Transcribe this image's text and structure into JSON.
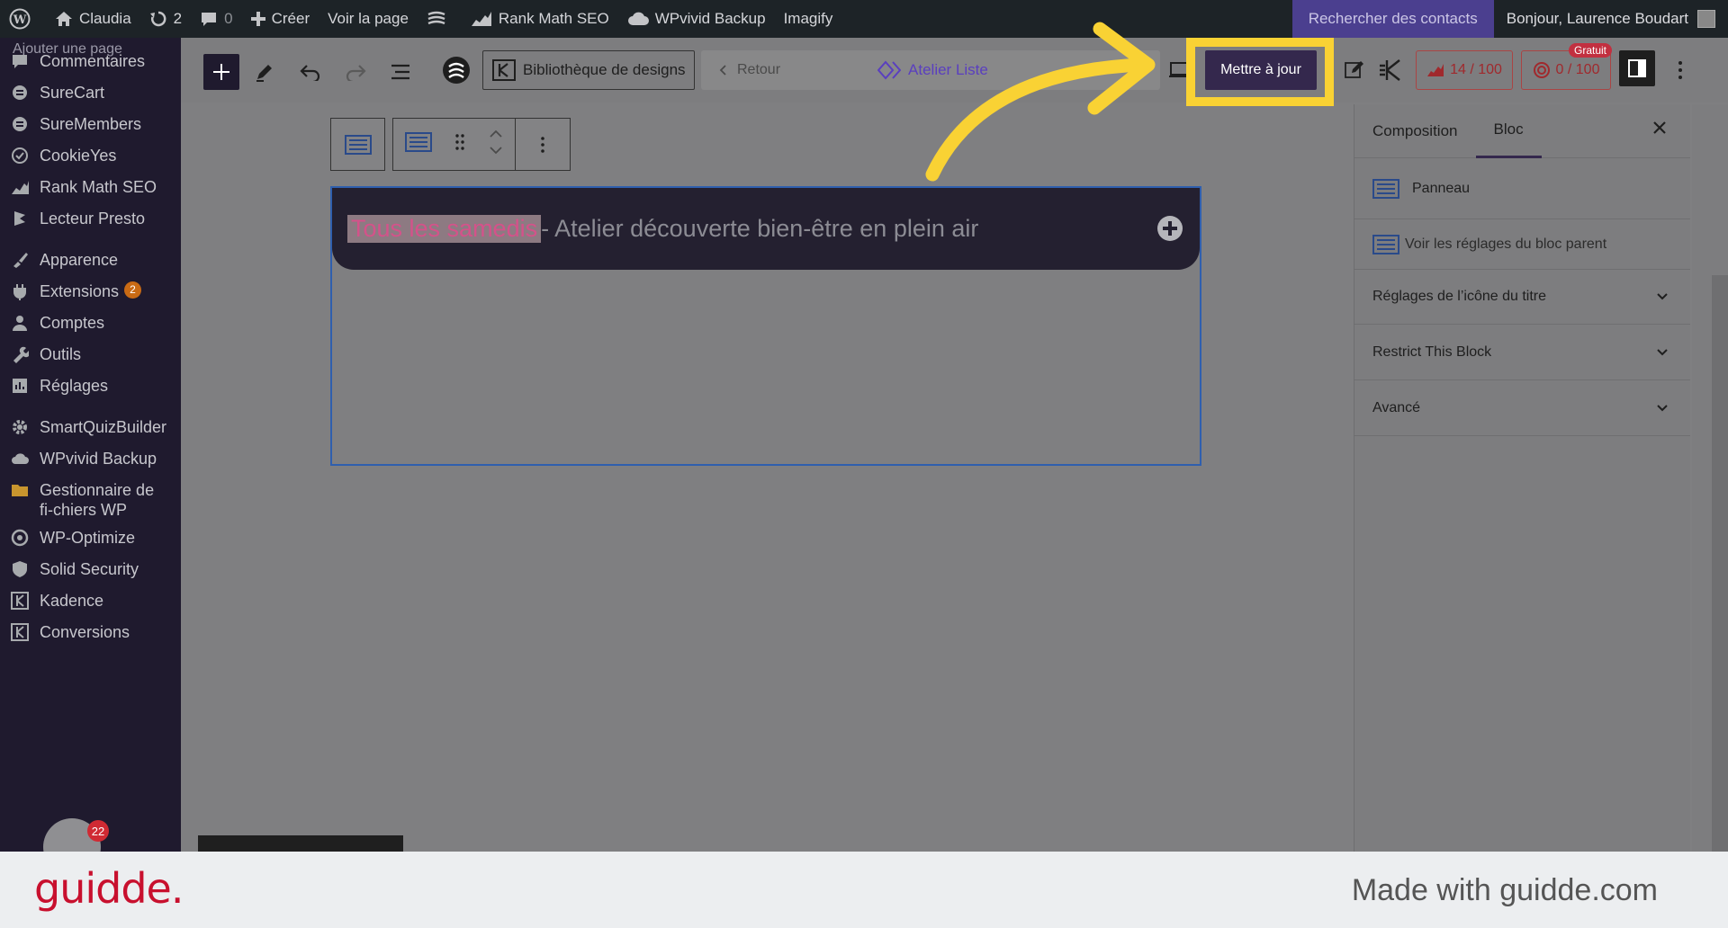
{
  "adminbar": {
    "site_name": "Claudia",
    "updates_count": "2",
    "comments_count": "0",
    "create_label": "Créer",
    "view_page_label": "Voir la page",
    "rankmath_label": "Rank Math SEO",
    "wpvivid_label": "WPvivid Backup",
    "imagify_label": "Imagify",
    "search_contacts_label": "Rechercher des contacts",
    "greeting": "Bonjour, Laurence Boudart"
  },
  "sidebar": {
    "submenu_tail": "Ajouter une page",
    "items": [
      {
        "label": "Commentaires",
        "icon": "comment-icon"
      },
      {
        "label": "SureCart",
        "icon": "surecart-icon"
      },
      {
        "label": "SureMembers",
        "icon": "suremembers-icon"
      },
      {
        "label": "CookieYes",
        "icon": "cookie-icon"
      },
      {
        "label": "Rank Math SEO",
        "icon": "rankmath-icon"
      },
      {
        "label": "Lecteur Presto",
        "icon": "presto-icon"
      },
      {
        "label": "Apparence",
        "icon": "brush-icon"
      },
      {
        "label": "Extensions",
        "icon": "plugin-icon",
        "badge": "2"
      },
      {
        "label": "Comptes",
        "icon": "user-icon"
      },
      {
        "label": "Outils",
        "icon": "wrench-icon"
      },
      {
        "label": "Réglages",
        "icon": "settings-icon"
      },
      {
        "label": "SmartQuizBuilder",
        "icon": "gear-icon"
      },
      {
        "label": "WPvivid Backup",
        "icon": "cloud-icon"
      },
      {
        "label": "Gestionnaire de fi-chiers WP",
        "icon": "folder-icon"
      },
      {
        "label": "WP-Optimize",
        "icon": "optimize-icon"
      },
      {
        "label": "Solid Security",
        "icon": "shield-icon"
      },
      {
        "label": "Kadence",
        "icon": "kadence-icon"
      },
      {
        "label": "Conversions",
        "icon": "kadence-icon"
      }
    ]
  },
  "toolbar": {
    "design_library_label": "Bibliothèque de designs",
    "back_label": "Retour",
    "doc_title": "Atelier Liste",
    "update_label": "Mettre à jour",
    "seo_score": "14 / 100",
    "content_score": "0 / 100",
    "free_tag": "Gratuit",
    "partial_letter": "K"
  },
  "canvas": {
    "highlight_text": "Tous les samedis",
    "title_rest": " - Atelier découverte bien-être en plein air"
  },
  "inspector": {
    "tab_composition": "Composition",
    "tab_bloc": "Bloc",
    "block_name": "Panneau",
    "parent_link": "Voir les réglages du bloc parent",
    "section_icon": "Réglages de l’icône du titre",
    "section_restrict": "Restrict This Block",
    "section_advanced": "Avancé"
  },
  "footer": {
    "logo_text": "guidde.",
    "made_with": "Made with guidde.com",
    "bubble_badge": "22"
  },
  "colors": {
    "accent": "#34284d",
    "highlight": "#f9d234",
    "brand": "#c8102e"
  }
}
